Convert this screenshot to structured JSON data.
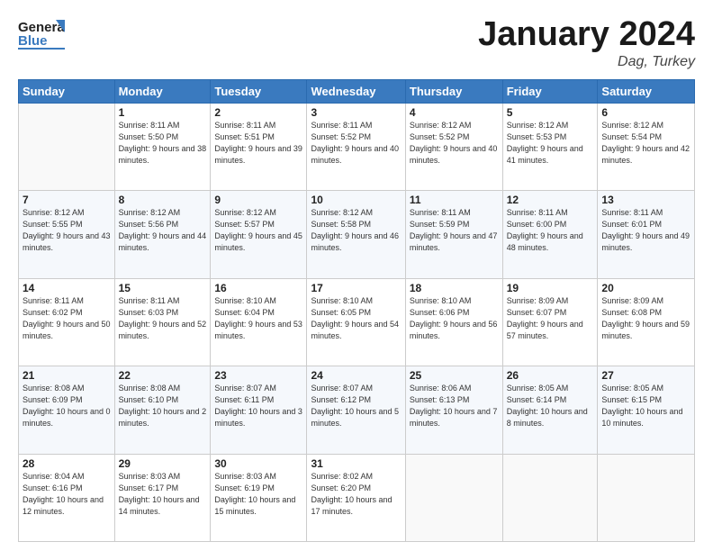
{
  "header": {
    "logo_general": "General",
    "logo_blue": "Blue",
    "month_title": "January 2024",
    "subtitle": "Dag, Turkey"
  },
  "columns": [
    "Sunday",
    "Monday",
    "Tuesday",
    "Wednesday",
    "Thursday",
    "Friday",
    "Saturday"
  ],
  "weeks": [
    [
      {
        "day": "",
        "sunrise": "",
        "sunset": "",
        "daylight": ""
      },
      {
        "day": "1",
        "sunrise": "Sunrise: 8:11 AM",
        "sunset": "Sunset: 5:50 PM",
        "daylight": "Daylight: 9 hours and 38 minutes."
      },
      {
        "day": "2",
        "sunrise": "Sunrise: 8:11 AM",
        "sunset": "Sunset: 5:51 PM",
        "daylight": "Daylight: 9 hours and 39 minutes."
      },
      {
        "day": "3",
        "sunrise": "Sunrise: 8:11 AM",
        "sunset": "Sunset: 5:52 PM",
        "daylight": "Daylight: 9 hours and 40 minutes."
      },
      {
        "day": "4",
        "sunrise": "Sunrise: 8:12 AM",
        "sunset": "Sunset: 5:52 PM",
        "daylight": "Daylight: 9 hours and 40 minutes."
      },
      {
        "day": "5",
        "sunrise": "Sunrise: 8:12 AM",
        "sunset": "Sunset: 5:53 PM",
        "daylight": "Daylight: 9 hours and 41 minutes."
      },
      {
        "day": "6",
        "sunrise": "Sunrise: 8:12 AM",
        "sunset": "Sunset: 5:54 PM",
        "daylight": "Daylight: 9 hours and 42 minutes."
      }
    ],
    [
      {
        "day": "7",
        "sunrise": "Sunrise: 8:12 AM",
        "sunset": "Sunset: 5:55 PM",
        "daylight": "Daylight: 9 hours and 43 minutes."
      },
      {
        "day": "8",
        "sunrise": "Sunrise: 8:12 AM",
        "sunset": "Sunset: 5:56 PM",
        "daylight": "Daylight: 9 hours and 44 minutes."
      },
      {
        "day": "9",
        "sunrise": "Sunrise: 8:12 AM",
        "sunset": "Sunset: 5:57 PM",
        "daylight": "Daylight: 9 hours and 45 minutes."
      },
      {
        "day": "10",
        "sunrise": "Sunrise: 8:12 AM",
        "sunset": "Sunset: 5:58 PM",
        "daylight": "Daylight: 9 hours and 46 minutes."
      },
      {
        "day": "11",
        "sunrise": "Sunrise: 8:11 AM",
        "sunset": "Sunset: 5:59 PM",
        "daylight": "Daylight: 9 hours and 47 minutes."
      },
      {
        "day": "12",
        "sunrise": "Sunrise: 8:11 AM",
        "sunset": "Sunset: 6:00 PM",
        "daylight": "Daylight: 9 hours and 48 minutes."
      },
      {
        "day": "13",
        "sunrise": "Sunrise: 8:11 AM",
        "sunset": "Sunset: 6:01 PM",
        "daylight": "Daylight: 9 hours and 49 minutes."
      }
    ],
    [
      {
        "day": "14",
        "sunrise": "Sunrise: 8:11 AM",
        "sunset": "Sunset: 6:02 PM",
        "daylight": "Daylight: 9 hours and 50 minutes."
      },
      {
        "day": "15",
        "sunrise": "Sunrise: 8:11 AM",
        "sunset": "Sunset: 6:03 PM",
        "daylight": "Daylight: 9 hours and 52 minutes."
      },
      {
        "day": "16",
        "sunrise": "Sunrise: 8:10 AM",
        "sunset": "Sunset: 6:04 PM",
        "daylight": "Daylight: 9 hours and 53 minutes."
      },
      {
        "day": "17",
        "sunrise": "Sunrise: 8:10 AM",
        "sunset": "Sunset: 6:05 PM",
        "daylight": "Daylight: 9 hours and 54 minutes."
      },
      {
        "day": "18",
        "sunrise": "Sunrise: 8:10 AM",
        "sunset": "Sunset: 6:06 PM",
        "daylight": "Daylight: 9 hours and 56 minutes."
      },
      {
        "day": "19",
        "sunrise": "Sunrise: 8:09 AM",
        "sunset": "Sunset: 6:07 PM",
        "daylight": "Daylight: 9 hours and 57 minutes."
      },
      {
        "day": "20",
        "sunrise": "Sunrise: 8:09 AM",
        "sunset": "Sunset: 6:08 PM",
        "daylight": "Daylight: 9 hours and 59 minutes."
      }
    ],
    [
      {
        "day": "21",
        "sunrise": "Sunrise: 8:08 AM",
        "sunset": "Sunset: 6:09 PM",
        "daylight": "Daylight: 10 hours and 0 minutes."
      },
      {
        "day": "22",
        "sunrise": "Sunrise: 8:08 AM",
        "sunset": "Sunset: 6:10 PM",
        "daylight": "Daylight: 10 hours and 2 minutes."
      },
      {
        "day": "23",
        "sunrise": "Sunrise: 8:07 AM",
        "sunset": "Sunset: 6:11 PM",
        "daylight": "Daylight: 10 hours and 3 minutes."
      },
      {
        "day": "24",
        "sunrise": "Sunrise: 8:07 AM",
        "sunset": "Sunset: 6:12 PM",
        "daylight": "Daylight: 10 hours and 5 minutes."
      },
      {
        "day": "25",
        "sunrise": "Sunrise: 8:06 AM",
        "sunset": "Sunset: 6:13 PM",
        "daylight": "Daylight: 10 hours and 7 minutes."
      },
      {
        "day": "26",
        "sunrise": "Sunrise: 8:05 AM",
        "sunset": "Sunset: 6:14 PM",
        "daylight": "Daylight: 10 hours and 8 minutes."
      },
      {
        "day": "27",
        "sunrise": "Sunrise: 8:05 AM",
        "sunset": "Sunset: 6:15 PM",
        "daylight": "Daylight: 10 hours and 10 minutes."
      }
    ],
    [
      {
        "day": "28",
        "sunrise": "Sunrise: 8:04 AM",
        "sunset": "Sunset: 6:16 PM",
        "daylight": "Daylight: 10 hours and 12 minutes."
      },
      {
        "day": "29",
        "sunrise": "Sunrise: 8:03 AM",
        "sunset": "Sunset: 6:17 PM",
        "daylight": "Daylight: 10 hours and 14 minutes."
      },
      {
        "day": "30",
        "sunrise": "Sunrise: 8:03 AM",
        "sunset": "Sunset: 6:19 PM",
        "daylight": "Daylight: 10 hours and 15 minutes."
      },
      {
        "day": "31",
        "sunrise": "Sunrise: 8:02 AM",
        "sunset": "Sunset: 6:20 PM",
        "daylight": "Daylight: 10 hours and 17 minutes."
      },
      {
        "day": "",
        "sunrise": "",
        "sunset": "",
        "daylight": ""
      },
      {
        "day": "",
        "sunrise": "",
        "sunset": "",
        "daylight": ""
      },
      {
        "day": "",
        "sunrise": "",
        "sunset": "",
        "daylight": ""
      }
    ]
  ]
}
